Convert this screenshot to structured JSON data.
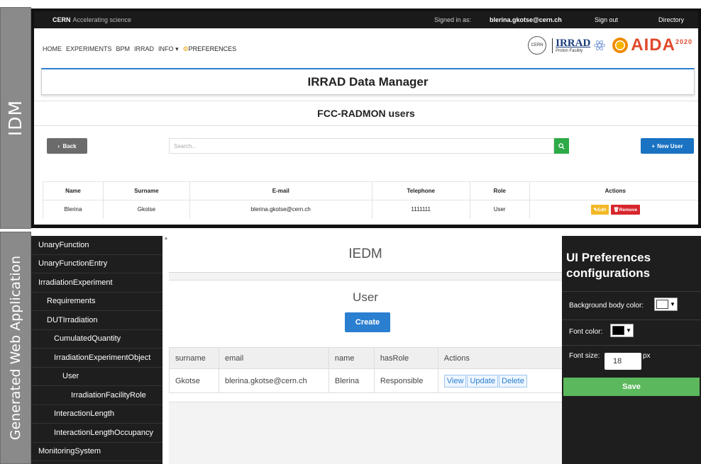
{
  "labels": {
    "idm": "IDM",
    "generated": "Generated Web Application"
  },
  "idm": {
    "topbar": {
      "brand": "CERN",
      "tagline": "Accelerating science",
      "signed_in_label": "Signed in as:",
      "email": "blerina.gkotse@cern.ch",
      "sign_out": "Sign out",
      "directory": "Directory"
    },
    "nav": {
      "items": [
        "HOME",
        "EXPERIMENTS",
        "BPM",
        "IRRAD",
        "INFO"
      ],
      "info_caret": "▾",
      "preferences": "PREFERENCES"
    },
    "logos": {
      "cern": "CERN",
      "irrad": "IRRAD",
      "irrad_sub": "Proton Facility",
      "aida": "AIDA",
      "aida_year": "2020"
    },
    "title": "IRRAD Data Manager",
    "subtitle": "FCC-RADMON users",
    "back_label": "Back",
    "search_placeholder": "Search...",
    "new_user_label": "New User",
    "table": {
      "headers": [
        "Name",
        "Surname",
        "E-mail",
        "Telephone",
        "Role",
        "Actions"
      ],
      "rows": [
        {
          "name": "Blerina",
          "surname": "Gkotse",
          "email": "blerina.gkotse@cern.ch",
          "telephone": "1111111",
          "role": "User",
          "edit": "Edit",
          "remove": "Remove"
        }
      ]
    }
  },
  "gen": {
    "sidebar": [
      {
        "label": "UnaryFunction",
        "indent": 0
      },
      {
        "label": "UnaryFunctionEntry",
        "indent": 0
      },
      {
        "label": "IrradiationExperiment",
        "indent": 0
      },
      {
        "label": "Requirements",
        "indent": 1
      },
      {
        "label": "DUTIrradiation",
        "indent": 1
      },
      {
        "label": "CumulatedQuantity",
        "indent": 2
      },
      {
        "label": "IrradiationExperimentObject",
        "indent": 2
      },
      {
        "label": "User",
        "indent": 3
      },
      {
        "label": "IrradiationFacilityRole",
        "indent": 4
      },
      {
        "label": "InteractionLength",
        "indent": 2
      },
      {
        "label": "InteractionLengthOccupancy",
        "indent": 2
      },
      {
        "label": "MonitoringSystem",
        "indent": 0
      }
    ],
    "main": {
      "title": "IEDM",
      "section": "User",
      "create": "Create",
      "table": {
        "headers": [
          "surname",
          "email",
          "name",
          "hasRole",
          "Actions"
        ],
        "rows": [
          {
            "surname": "Gkotse",
            "email": "blerina.gkotse@cern.ch",
            "name": "Blerina",
            "hasRole": "Responsible"
          }
        ],
        "actions": [
          "View",
          "Update",
          "Delete"
        ]
      }
    },
    "prefs": {
      "title": "UI Preferences configurations",
      "bg_label": "Background body color:",
      "bg_color": "#ffffff",
      "font_color_label": "Font color:",
      "font_color": "#000000",
      "font_size_label": "Font size:",
      "font_size": "18",
      "unit": "px",
      "save": "Save"
    }
  },
  "colors": {
    "accent_blue": "#1a72c2",
    "search_green": "#2eaa47",
    "save_green": "#5cb85c",
    "edit_yellow": "#f2b826",
    "remove_red": "#d7262c"
  }
}
